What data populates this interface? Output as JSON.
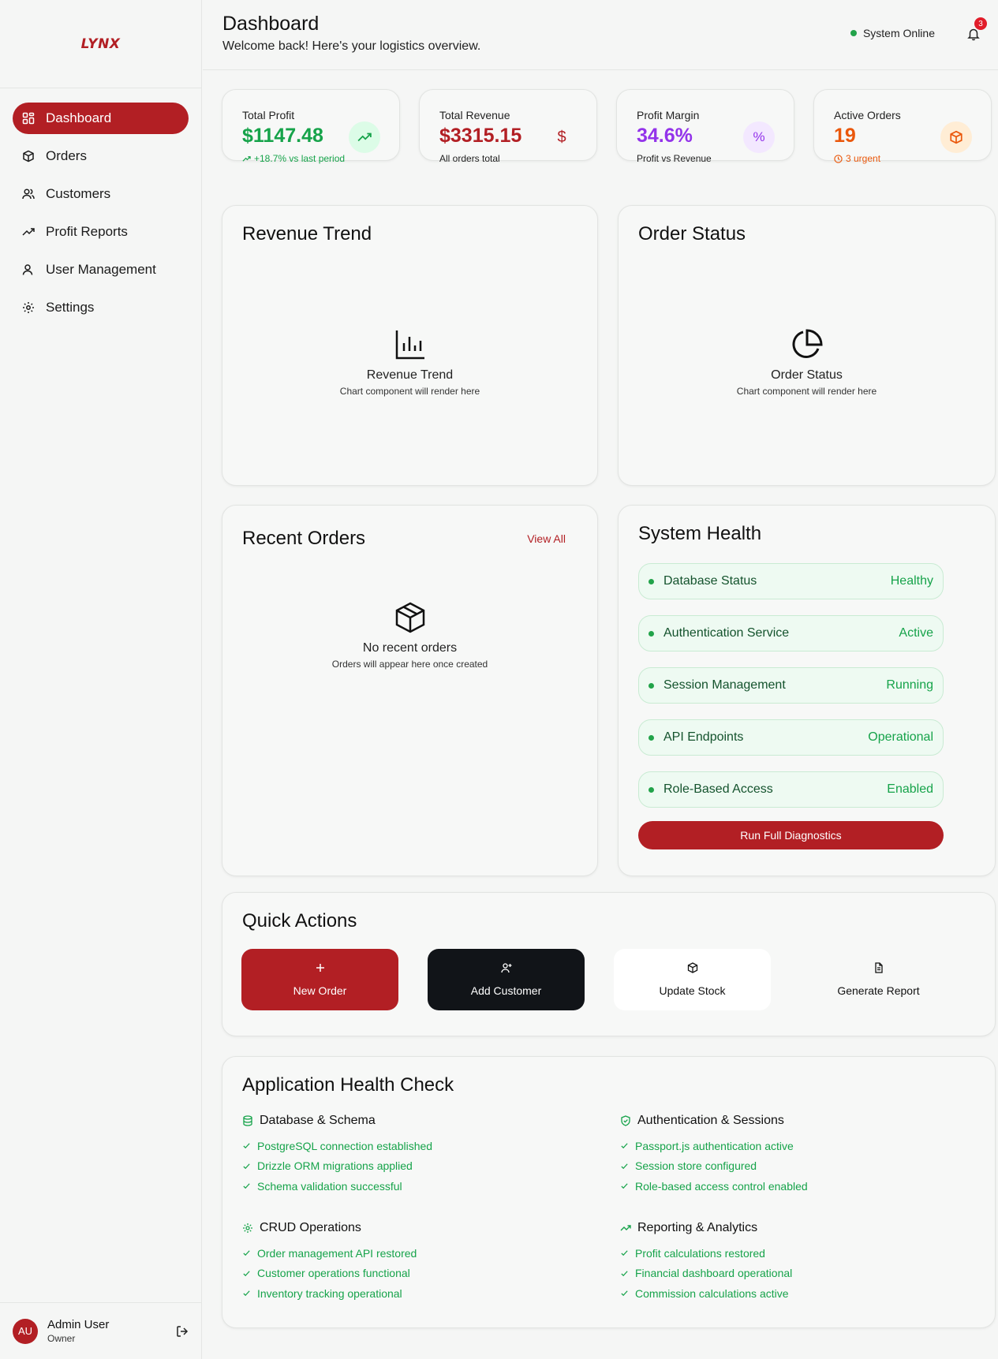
{
  "brand": {
    "logo_text": "LYNX"
  },
  "sidebar": {
    "items": [
      {
        "label": "Dashboard",
        "icon": "dashboard-grid-icon",
        "active": true
      },
      {
        "label": "Orders",
        "icon": "box-icon"
      },
      {
        "label": "Customers",
        "icon": "users-icon"
      },
      {
        "label": "Profit Reports",
        "icon": "trend-icon"
      },
      {
        "label": "User Management",
        "icon": "user-cog-icon"
      },
      {
        "label": "Settings",
        "icon": "gear-icon"
      }
    ],
    "user": {
      "initials": "AU",
      "name": "Admin User",
      "role": "Owner"
    }
  },
  "header": {
    "title": "Dashboard",
    "subtitle": "Welcome back! Here's your logistics overview.",
    "status": "System Online",
    "notifications": "3"
  },
  "stats": [
    {
      "label": "Total Profit",
      "value": "$1147.48",
      "sub": "+18.7% vs last period",
      "color": "#16a34a",
      "icon": "trend-up-icon"
    },
    {
      "label": "Total Revenue",
      "value": "$3315.15",
      "sub": "All orders total",
      "color": "#b21f24",
      "icon": "dollar-icon"
    },
    {
      "label": "Profit Margin",
      "value": "34.6%",
      "sub": "Profit vs Revenue",
      "color": "#9333ea",
      "icon": "percent-icon"
    },
    {
      "label": "Active Orders",
      "value": "19",
      "sub": "3 urgent",
      "color": "#ea580c",
      "icon": "package-icon"
    }
  ],
  "revenue_trend": {
    "title": "Revenue Trend",
    "ph_title": "Revenue Trend",
    "ph_sub": "Chart component will render here"
  },
  "order_status": {
    "title": "Order Status",
    "ph_title": "Order Status",
    "ph_sub": "Chart component will render here"
  },
  "recent_orders": {
    "title": "Recent Orders",
    "view_all": "View All",
    "empty_title": "No recent orders",
    "empty_sub": "Orders will appear here once created"
  },
  "system_health": {
    "title": "System Health",
    "rows": [
      {
        "name": "Database Status",
        "value": "Healthy"
      },
      {
        "name": "Authentication Service",
        "value": "Active"
      },
      {
        "name": "Session Management",
        "value": "Running"
      },
      {
        "name": "API Endpoints",
        "value": "Operational"
      },
      {
        "name": "Role-Based Access",
        "value": "Enabled"
      }
    ],
    "button": "Run Full Diagnostics"
  },
  "quick_actions": {
    "title": "Quick Actions",
    "buttons": [
      {
        "label": "New Order",
        "icon": "plus-icon"
      },
      {
        "label": "Add Customer",
        "icon": "user-plus-icon"
      },
      {
        "label": "Update Stock",
        "icon": "package-icon"
      },
      {
        "label": "Generate Report",
        "icon": "file-icon"
      }
    ]
  },
  "health_check": {
    "title": "Application Health Check",
    "sections": [
      {
        "title": "Database & Schema",
        "icon": "database-icon",
        "items": [
          "PostgreSQL connection established",
          "Drizzle ORM migrations applied",
          "Schema validation successful"
        ]
      },
      {
        "title": "Authentication & Sessions",
        "icon": "shield-check-icon",
        "items": [
          "Passport.js authentication active",
          "Session store configured",
          "Role-based access control enabled"
        ]
      },
      {
        "title": "CRUD Operations",
        "icon": "gear-icon",
        "items": [
          "Order management API restored",
          "Customer operations functional",
          "Inventory tracking operational"
        ]
      },
      {
        "title": "Reporting & Analytics",
        "icon": "trend-up-icon",
        "items": [
          "Profit calculations restored",
          "Financial dashboard operational",
          "Commission calculations active"
        ]
      }
    ]
  },
  "colors": {
    "accent": "#b21f24",
    "success": "#16a34a",
    "dark": "#111418"
  }
}
